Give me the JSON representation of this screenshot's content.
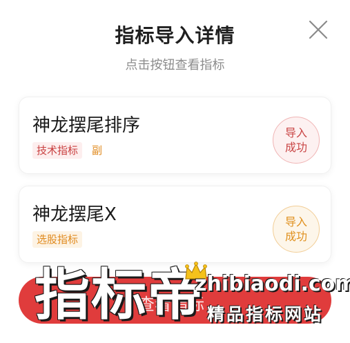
{
  "dialog": {
    "title": "指标导入详情",
    "subtitle": "点击按钮查看指标"
  },
  "items": [
    {
      "name": "神龙摆尾排序",
      "tags": [
        "技术指标",
        "副"
      ],
      "status_line1": "导入",
      "status_line2": "成功",
      "status_color": "#c94545"
    },
    {
      "name": "神龙摆尾X",
      "tags": [
        "选股指标"
      ],
      "status_line1": "导入",
      "status_line2": "成功",
      "status_color": "#e0901e"
    }
  ],
  "confirm_button": {
    "label": "查看指标"
  },
  "watermark": {
    "logo_text": "指标帝",
    "url": "zhibiaodi.com",
    "slogan": "精品指标网站"
  },
  "icons": {
    "close": "close-icon",
    "crown": "crown-icon"
  }
}
